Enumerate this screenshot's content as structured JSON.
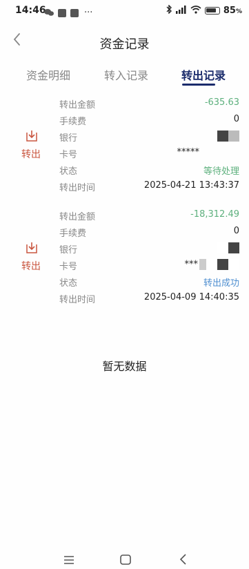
{
  "status_bar": {
    "time": "14:46",
    "ellipsis": "···",
    "battery": "85",
    "battery_pct_fill": 0.85
  },
  "header": {
    "title": "资金记录",
    "back_icon": "chevron-left-icon"
  },
  "tabs": [
    {
      "label": "资金明细",
      "active": false
    },
    {
      "label": "转入记录",
      "active": false
    },
    {
      "label": "转出记录",
      "active": true
    }
  ],
  "records": [
    {
      "type_label": "转出",
      "amount_label": "转出金额",
      "amount": "-635.63",
      "fee_label": "手续费",
      "fee": "0",
      "bank_label": "银行",
      "bank": "",
      "card_label": "卡号",
      "card": "*****",
      "status_label": "状态",
      "status": "等待处理",
      "time_label": "转出时间",
      "time": "2025-04-21 13:43:37"
    },
    {
      "type_label": "转出",
      "amount_label": "转出金额",
      "amount": "-18,312.49",
      "fee_label": "手续费",
      "fee": "0",
      "bank_label": "银行",
      "bank": "",
      "card_label": "卡号",
      "card": "***",
      "status_label": "状态",
      "status": "转出成功",
      "time_label": "转出时间",
      "time": "2025-04-09 14:40:35"
    }
  ],
  "empty_text": "暂无数据",
  "colors": {
    "accent": "#1a2b6b",
    "negative": "#5db07d",
    "pending": "#5db07d",
    "success": "#4f8fd0",
    "type": "#c9553f"
  }
}
